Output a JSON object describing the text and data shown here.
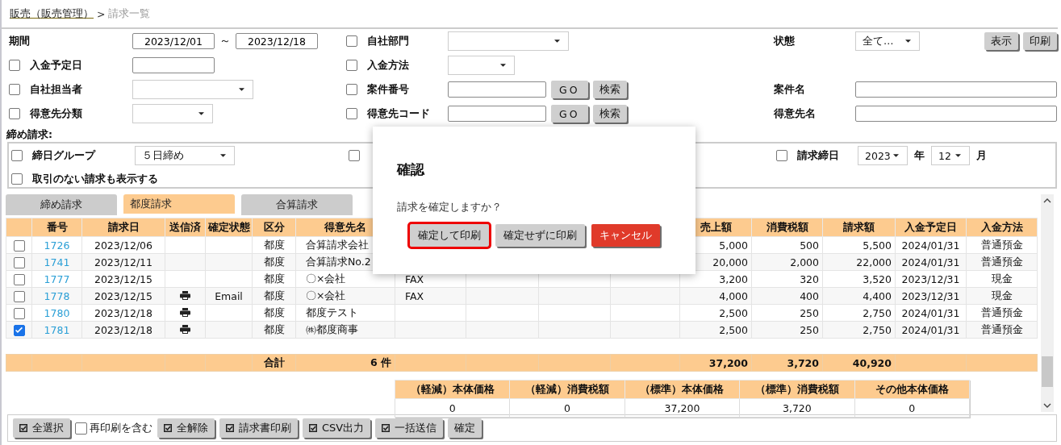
{
  "breadcrumb": {
    "parent": "販売（販売管理）",
    "separator": ">",
    "current": "請求一覧"
  },
  "filters": {
    "period": {
      "label": "期間",
      "from": "2023/12/01",
      "separator": "～",
      "to": "2023/12/18"
    },
    "department": {
      "label": "自社部門",
      "checked": false
    },
    "status": {
      "label": "状態",
      "value": "全て…"
    },
    "actions": [
      "表示",
      "印刷"
    ],
    "payment_date": {
      "label": "入金予定日",
      "checked": false
    },
    "payment_method": {
      "label": "入金方法",
      "checked": false
    },
    "staff": {
      "label": "自社担当者",
      "checked": false
    },
    "project_no": {
      "label": "案件番号",
      "checked": false,
      "buttons": [
        "GO",
        "検索"
      ]
    },
    "project_name": {
      "label": "案件名"
    },
    "customer_class": {
      "label": "得意先分類",
      "checked": false
    },
    "customer_code": {
      "label": "得意先コード",
      "checked": false,
      "buttons": [
        "GO",
        "検索"
      ]
    },
    "customer_name": {
      "label": "得意先名"
    }
  },
  "closing": {
    "title": "締め請求:",
    "group": {
      "label": "締日グループ",
      "checked": false,
      "value": "５日締め"
    },
    "covered": {
      "checked": false
    },
    "closing_date": {
      "label": "請求締日",
      "checked": false,
      "year": "2023",
      "year_unit": "年",
      "month": "12",
      "month_unit": "月"
    },
    "show_empty": {
      "label": "取引のない請求も表示する",
      "checked": false
    }
  },
  "tabs": [
    {
      "label": "締め請求",
      "selected": false
    },
    {
      "label": "都度請求",
      "selected": true
    },
    {
      "label": "合算請求",
      "selected": false
    }
  ],
  "table": {
    "columns": [
      {},
      {
        "label": "番号"
      },
      {
        "label": "請求日"
      },
      {
        "label": "送信済"
      },
      {
        "label": "確定状態"
      },
      {
        "label": "区分"
      },
      {
        "label": "得意先名"
      },
      {},
      {},
      {},
      {},
      {
        "label": "売上額"
      },
      {
        "label": "消費税額"
      },
      {
        "label": "請求額"
      },
      {
        "label": "入金予定日"
      },
      {
        "label": "入金方法"
      }
    ],
    "rows": [
      {
        "checked": false,
        "number": "1726",
        "date": "2023/12/06",
        "sent": false,
        "state": "",
        "kind": "都度",
        "customer": "合算請求会社",
        "column_8": "",
        "sales": "5,000",
        "tax": "500",
        "total": "5,500",
        "due": "2024/01/31",
        "method": "普通預金"
      },
      {
        "checked": false,
        "number": "1741",
        "date": "2023/12/11",
        "sent": false,
        "state": "",
        "kind": "都度",
        "customer": "合算請求No.2",
        "column_8": "",
        "sales": "20,000",
        "tax": "2,000",
        "total": "22,000",
        "due": "2024/01/31",
        "method": "普通預金"
      },
      {
        "checked": false,
        "number": "1777",
        "date": "2023/12/15",
        "sent": false,
        "state": "",
        "kind": "都度",
        "customer": "〇×会社",
        "column_8": "FAX",
        "sales": "3,200",
        "tax": "320",
        "total": "3,520",
        "due": "2023/12/31",
        "method": "現金"
      },
      {
        "checked": false,
        "number": "1778",
        "date": "2023/12/15",
        "sent": true,
        "state": "Email",
        "kind": "都度",
        "customer": "〇×会社",
        "column_8": "FAX",
        "sales": "4,000",
        "tax": "400",
        "total": "4,400",
        "due": "2023/12/31",
        "method": "現金"
      },
      {
        "checked": false,
        "number": "1780",
        "date": "2023/12/18",
        "sent": true,
        "state": "",
        "kind": "都度",
        "customer": "都度テスト",
        "column_8": "",
        "sales": "2,500",
        "tax": "250",
        "total": "2,750",
        "due": "2024/01/31",
        "method": "普通預金"
      },
      {
        "checked": true,
        "number": "1781",
        "date": "2023/12/18",
        "sent": true,
        "state": "",
        "kind": "都度",
        "customer": "㈱都度商事",
        "column_8": "",
        "sales": "2,500",
        "tax": "250",
        "total": "2,750",
        "due": "2024/01/31",
        "method": "普通預金"
      }
    ],
    "totals": {
      "label": "合計",
      "count": "6 件",
      "sales": "37,200",
      "tax": "3,720",
      "total": "40,920"
    }
  },
  "summary": {
    "columns": [
      "（軽減）本体価格",
      "（軽減）消費税額",
      "（標準）本体価格",
      "（標準）消費税額",
      "その他本体価格"
    ],
    "values": [
      "0",
      "0",
      "37,200",
      "3,720",
      "0"
    ]
  },
  "toolbar": [
    {
      "kind": "button",
      "label": "全選択",
      "icon": true
    },
    {
      "kind": "checkbox",
      "label": "再印刷を含む",
      "checked": false
    },
    {
      "kind": "button",
      "label": "全解除",
      "icon": true
    },
    {
      "kind": "button",
      "label": "請求書印刷",
      "icon": true
    },
    {
      "kind": "button",
      "label": "CSV出力",
      "icon": true
    },
    {
      "kind": "button",
      "label": "一括送信",
      "icon": true
    },
    {
      "kind": "button",
      "label": "確定",
      "icon": false
    }
  ],
  "dialog": {
    "title": "確認",
    "message": "請求を確定しますか？",
    "buttons": [
      {
        "label": "確定して印刷",
        "kind": "default",
        "focused": true
      },
      {
        "label": "確定せずに印刷",
        "kind": "default",
        "focused": false
      },
      {
        "label": "キャンセル",
        "kind": "danger",
        "focused": false
      }
    ]
  }
}
